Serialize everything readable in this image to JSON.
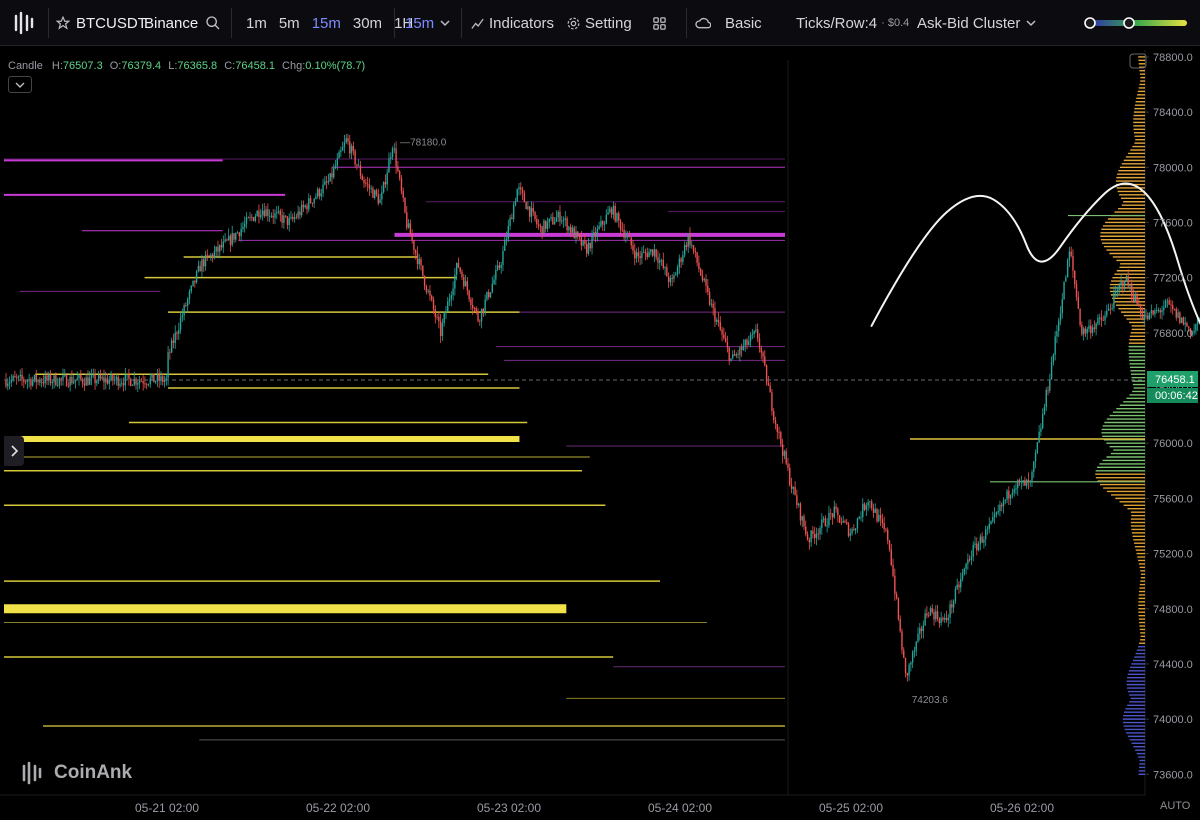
{
  "toolbar": {
    "symbol": "BTCUSDT",
    "exchange": "Binance",
    "timeframes": [
      "1m",
      "5m",
      "15m",
      "30m",
      "1H"
    ],
    "active_timeframe": "15m",
    "selected_timeframe": "15m",
    "indicators_label": "Indicators",
    "setting_label": "Setting",
    "mode_label": "Basic",
    "ticks_row_label": "Ticks/Row:4",
    "ticks_value": "· $0.4",
    "cluster_label": "Ask-Bid Cluster",
    "accent_color": "#7c8cff"
  },
  "legend": {
    "type_label": "Candle",
    "h_label": "H:",
    "h_value": "76507.3",
    "o_label": "O:",
    "o_value": "76379.4",
    "l_label": "L:",
    "l_value": "76365.8",
    "c_label": "C:",
    "c_value": "76458.1",
    "chg_label": "Chg:",
    "chg_value": "0.10%(78.7)"
  },
  "watermark": "CoinAnk",
  "auto_label": "AUTO",
  "chart_data": {
    "type": "candlestick",
    "symbol": "BTCUSDT",
    "interval": "15m",
    "ylim": [
      73450,
      78850
    ],
    "y_ticks": [
      "78800.0",
      "78400.0",
      "78000.0",
      "77600.0",
      "77200.0",
      "76800.0",
      "76400.0",
      "76000.0",
      "75600.0",
      "75200.0",
      "74800.0",
      "74400.0",
      "74000.0",
      "73600.0"
    ],
    "x_ticks": [
      "05-21 02:00",
      "05-22 02:00",
      "05-23 02:00",
      "05-24 02:00",
      "05-25 02:00",
      "05-26 02:00"
    ],
    "current_price": "76458.1",
    "countdown": "00:06:42",
    "annotations": {
      "high_label": "78180.0",
      "low_label": "74203.6"
    },
    "price_path": [
      [
        0,
        76600
      ],
      [
        0.08,
        76900
      ],
      [
        0.2,
        77300
      ],
      [
        0.35,
        77450
      ],
      [
        0.55,
        77700
      ],
      [
        0.72,
        77600
      ],
      [
        0.95,
        77900
      ],
      [
        1.05,
        78200
      ],
      [
        1.15,
        77900
      ],
      [
        1.25,
        77750
      ],
      [
        1.32,
        78180
      ],
      [
        1.4,
        77600
      ],
      [
        1.5,
        77200
      ],
      [
        1.6,
        76800
      ],
      [
        1.7,
        77300
      ],
      [
        1.82,
        76900
      ],
      [
        1.95,
        77300
      ],
      [
        2.05,
        77850
      ],
      [
        2.18,
        77550
      ],
      [
        2.3,
        77650
      ],
      [
        2.45,
        77400
      ],
      [
        2.6,
        77700
      ],
      [
        2.75,
        77350
      ],
      [
        2.85,
        77400
      ],
      [
        2.95,
        77150
      ],
      [
        3.05,
        77500
      ],
      [
        3.18,
        77000
      ],
      [
        3.3,
        76600
      ],
      [
        3.45,
        76800
      ],
      [
        3.55,
        76200
      ],
      [
        3.65,
        75700
      ],
      [
        3.75,
        75300
      ],
      [
        3.9,
        75500
      ],
      [
        4.0,
        75350
      ],
      [
        4.1,
        75600
      ],
      [
        4.22,
        75300
      ],
      [
        4.32,
        74300
      ],
      [
        4.45,
        74800
      ],
      [
        4.55,
        74700
      ],
      [
        4.7,
        75200
      ],
      [
        4.82,
        75400
      ],
      [
        4.95,
        75700
      ],
      [
        5.05,
        75700
      ],
      [
        5.15,
        76400
      ],
      [
        5.28,
        77400
      ],
      [
        5.35,
        76800
      ],
      [
        5.48,
        76900
      ],
      [
        5.6,
        77200
      ],
      [
        5.72,
        76900
      ],
      [
        5.85,
        77000
      ],
      [
        6.0,
        76800
      ],
      [
        6.1,
        77100
      ],
      [
        6.2,
        77300
      ],
      [
        6.32,
        76900
      ],
      [
        6.45,
        77300
      ],
      [
        6.52,
        77100
      ],
      [
        6.6,
        76800
      ],
      [
        6.7,
        76350
      ],
      [
        6.75,
        76458
      ]
    ],
    "drawing": {
      "type": "freehand",
      "points": [
        [
          4.12,
          76850
        ],
        [
          4.4,
          77500
        ],
        [
          4.72,
          77850
        ],
        [
          4.95,
          77680
        ],
        [
          5.1,
          77200
        ],
        [
          5.35,
          77650
        ],
        [
          5.6,
          77950
        ],
        [
          5.82,
          77700
        ],
        [
          6.0,
          76950
        ],
        [
          6.2,
          76500
        ],
        [
          6.42,
          76000
        ],
        [
          6.52,
          75600
        ]
      ]
    },
    "levels": [
      {
        "price": 78050,
        "x0": 0,
        "x1": 0.28,
        "color": "#c93bd6",
        "width": 2
      },
      {
        "price": 77800,
        "x0": 0,
        "x1": 0.36,
        "color": "#c93bd6",
        "width": 2
      },
      {
        "price": 78060,
        "x0": 0,
        "x1": 1,
        "color": "#5a1a66",
        "width": 1
      },
      {
        "price": 78000,
        "x0": 0.42,
        "x1": 1,
        "color": "#b435c4",
        "width": 1
      },
      {
        "price": 77750,
        "x0": 0.54,
        "x1": 1,
        "color": "#5a1a66",
        "width": 1
      },
      {
        "price": 77680,
        "x0": 0.85,
        "x1": 1,
        "color": "#5a1a66",
        "width": 1
      },
      {
        "price": 77540,
        "x0": 0.1,
        "x1": 0.28,
        "color": "#c93bd6",
        "width": 1
      },
      {
        "price": 77510,
        "x0": 0.5,
        "x1": 1,
        "color": "#c93bd6",
        "width": 4
      },
      {
        "price": 77470,
        "x0": 0.3,
        "x1": 1,
        "color": "#a030b0",
        "width": 1
      },
      {
        "price": 77100,
        "x0": 0.02,
        "x1": 0.2,
        "color": "#7a2a88",
        "width": 1
      },
      {
        "price": 76950,
        "x0": 0.62,
        "x1": 1,
        "color": "#7a2a88",
        "width": 1
      },
      {
        "price": 76700,
        "x0": 0.63,
        "x1": 1,
        "color": "#7a2a88",
        "width": 1
      },
      {
        "price": 76600,
        "x0": 0.64,
        "x1": 1,
        "color": "#7a2a88",
        "width": 1
      },
      {
        "price": 75980,
        "x0": 0.72,
        "x1": 1,
        "color": "#6a2a78",
        "width": 1
      },
      {
        "price": 74380,
        "x0": 0.78,
        "x1": 1,
        "color": "#6a2a78",
        "width": 1
      },
      {
        "price": 77350,
        "x0": 0.23,
        "x1": 0.53,
        "color": "#d6c83a",
        "width": 1.5
      },
      {
        "price": 77200,
        "x0": 0.18,
        "x1": 0.58,
        "color": "#d6c83a",
        "width": 1.5
      },
      {
        "price": 76950,
        "x0": 0.21,
        "x1": 0.66,
        "color": "#d6c83a",
        "width": 1.5
      },
      {
        "price": 76500,
        "x0": 0.04,
        "x1": 0.62,
        "color": "#d6c83a",
        "width": 1.5
      },
      {
        "price": 76400,
        "x0": 0.21,
        "x1": 0.66,
        "color": "#d6c83a",
        "width": 1.5
      },
      {
        "price": 76150,
        "x0": 0.16,
        "x1": 0.67,
        "color": "#d6c83a",
        "width": 1.5
      },
      {
        "price": 76030,
        "x0": 0.0,
        "x1": 0.66,
        "color": "#f2e24a",
        "width": 6
      },
      {
        "price": 75900,
        "x0": 0.0,
        "x1": 0.75,
        "color": "#b8ad34",
        "width": 1
      },
      {
        "price": 75800,
        "x0": 0.0,
        "x1": 0.74,
        "color": "#d6c83a",
        "width": 1.5
      },
      {
        "price": 75550,
        "x0": 0.0,
        "x1": 0.77,
        "color": "#d6c83a",
        "width": 1.5
      },
      {
        "price": 75000,
        "x0": 0.0,
        "x1": 0.84,
        "color": "#d6c83a",
        "width": 1.5
      },
      {
        "price": 74800,
        "x0": 0.0,
        "x1": 0.72,
        "color": "#f2e24a",
        "width": 9
      },
      {
        "price": 74700,
        "x0": 0.0,
        "x1": 0.9,
        "color": "#8a8128",
        "width": 1
      },
      {
        "price": 74450,
        "x0": 0.0,
        "x1": 0.78,
        "color": "#d6c83a",
        "width": 1.5
      },
      {
        "price": 74150,
        "x0": 0.72,
        "x1": 1,
        "color": "#8a8128",
        "width": 1
      },
      {
        "price": 73950,
        "x0": 0.05,
        "x1": 1,
        "color": "#8a8128",
        "width": 2
      },
      {
        "price": 73850,
        "x0": 0.25,
        "x1": 1,
        "color": "#555",
        "width": 1
      }
    ],
    "colors": {
      "up": "#26a69a",
      "down": "#ef5350",
      "current_label_bg": "#1fa06a",
      "countdown_bg": "#158a5a"
    },
    "grid": false,
    "volume_profile": true
  }
}
